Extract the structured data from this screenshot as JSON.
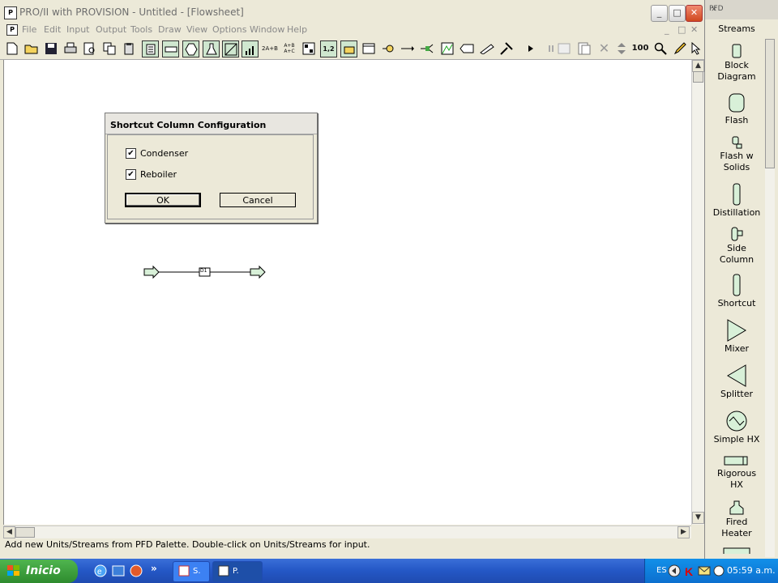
{
  "window": {
    "title": "PRO/II with PROVISION - Untitled - [Flowsheet]",
    "minimize_glyph": "_",
    "maximize_glyph": "□",
    "close_glyph": "✕"
  },
  "menu": [
    "File",
    "Edit",
    "Input",
    "Output",
    "Tools",
    "Draw",
    "View",
    "Options",
    "Window",
    "Help"
  ],
  "menu_controls": {
    "minimize": "_",
    "restore": "□",
    "close": "✕"
  },
  "toolbar": {
    "text_buttons": {
      "ab": "2A+B",
      "rxn": "A+B\nA+C",
      "num": "1,2",
      "hundred": "100"
    }
  },
  "dialog": {
    "title": "Shortcut Column Configuration",
    "condenser_label": "Condenser",
    "condenser_checked": true,
    "reboiler_label": "Reboiler",
    "reboiler_checked": true,
    "ok_label": "OK",
    "cancel_label": "Cancel"
  },
  "flowsheet": {
    "unit_label": "D1"
  },
  "status": {
    "text": "Add new Units/Streams from PFD Palette.  Double-click on Units/Streams for input."
  },
  "palette": {
    "title": "PFD",
    "close_glyph": "✕",
    "header": "Streams",
    "items": [
      {
        "label": "Block\nDiagram",
        "icon": "block-diagram-icon"
      },
      {
        "label": "Flash",
        "icon": "flash-drum-icon"
      },
      {
        "label": "Flash w\nSolids",
        "icon": "flash-solids-icon"
      },
      {
        "label": "Distillation",
        "icon": "distillation-column-icon"
      },
      {
        "label": "Side\nColumn",
        "icon": "side-column-icon"
      },
      {
        "label": "Shortcut",
        "icon": "shortcut-column-icon"
      },
      {
        "label": "Mixer",
        "icon": "mixer-icon"
      },
      {
        "label": "Splitter",
        "icon": "splitter-icon"
      },
      {
        "label": "Simple HX",
        "icon": "simple-hx-icon"
      },
      {
        "label": "Rigorous\nHX",
        "icon": "rigorous-hx-icon"
      },
      {
        "label": "Fired\nHeater",
        "icon": "fired-heater-icon"
      }
    ],
    "accent_color": "#8fd18f"
  },
  "taskbar": {
    "start_label": "Inicio",
    "items": [
      {
        "label": "S."
      },
      {
        "label": "P."
      }
    ],
    "language": "ES",
    "clock": "05:59 a.m.",
    "overflow": "»"
  }
}
